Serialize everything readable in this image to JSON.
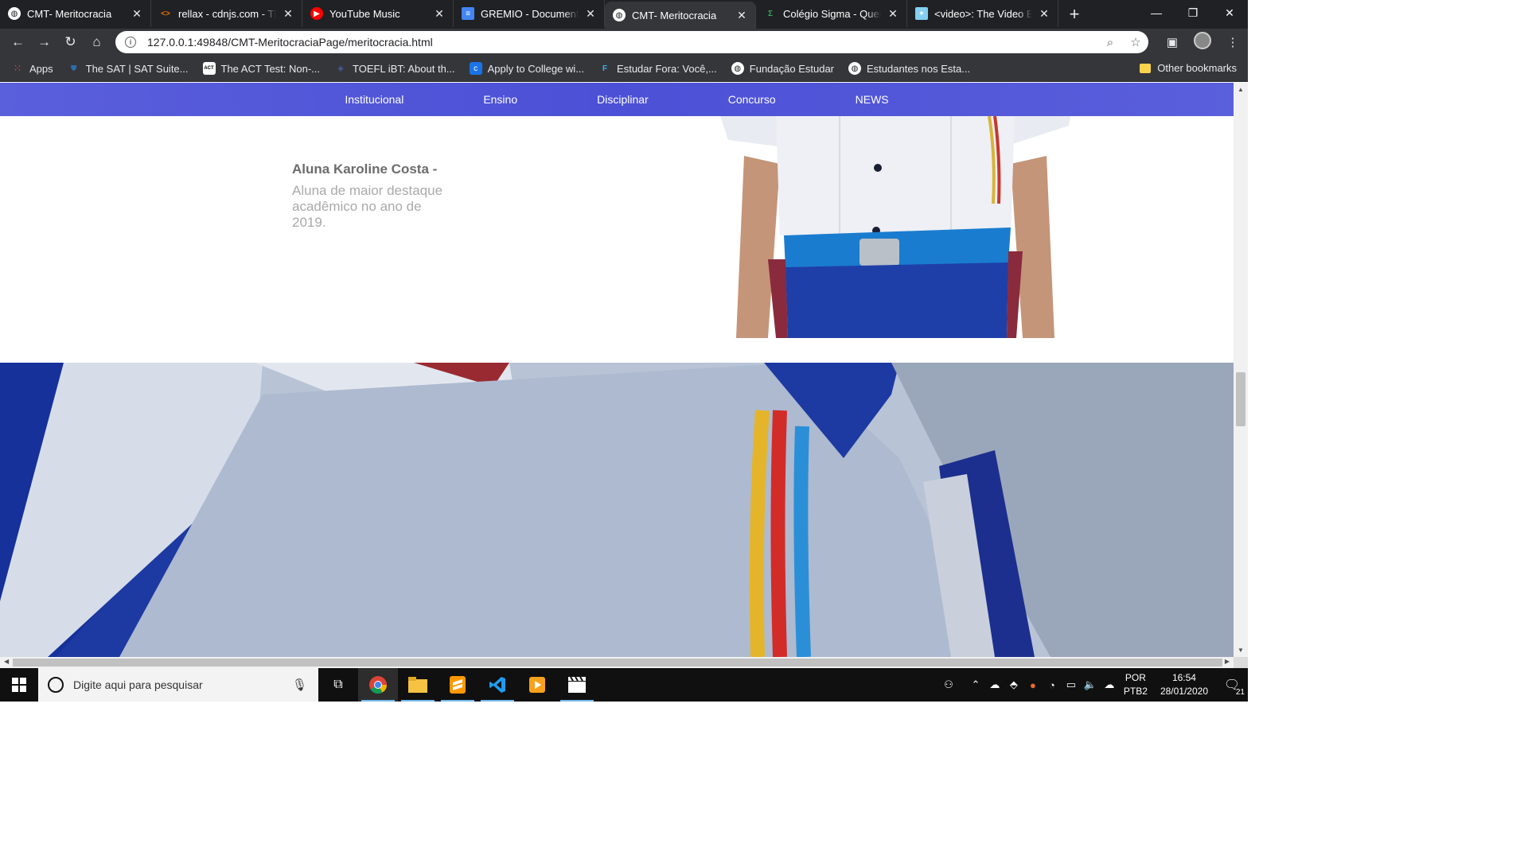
{
  "tabs": [
    {
      "title": "CMT- Meritocracia",
      "icon": "globe-icon",
      "active": false
    },
    {
      "title": "rellax - cdnjs.com - The",
      "icon": "code-icon",
      "active": false
    },
    {
      "title": "YouTube Music",
      "icon": "youtube-music-icon",
      "active": false
    },
    {
      "title": "GREMIO - Documento",
      "icon": "docs-icon",
      "active": false
    },
    {
      "title": "CMT- Meritocracia",
      "icon": "globe-icon",
      "active": true
    },
    {
      "title": "Colégio Sigma - Quem",
      "icon": "sigma-icon",
      "active": false
    },
    {
      "title": "<video>: The Video Em",
      "icon": "mdn-icon",
      "active": false
    }
  ],
  "address_bar": {
    "url": "127.0.0.1:49848/CMT-MeritocraciaPage/meritocracia.html"
  },
  "bookmarks": [
    {
      "label": "Apps",
      "icon": "apps-grid-icon"
    },
    {
      "label": "The SAT | SAT Suite...",
      "icon": "shield-icon"
    },
    {
      "label": "The ACT Test: Non-...",
      "icon": "act-icon"
    },
    {
      "label": "TOEFL iBT: About th...",
      "icon": "ets-icon"
    },
    {
      "label": "Apply to College wi...",
      "icon": "commonapp-icon"
    },
    {
      "label": "Estudar Fora: Você,...",
      "icon": "ef-icon"
    },
    {
      "label": "Fundação Estudar",
      "icon": "globe-icon"
    },
    {
      "label": "Estudantes nos Esta...",
      "icon": "globe-icon"
    }
  ],
  "other_bookmarks": "Other bookmarks",
  "site_nav": [
    "Institucional",
    "Ensino",
    "Disciplinar",
    "Concurso",
    "NEWS"
  ],
  "student": {
    "name": "Aluna Karoline Costa -",
    "description": "Aluna de maior destaque acadêmico no ano de 2019."
  },
  "taskbar": {
    "search_placeholder": "Digite aqui para pesquisar",
    "language": "POR",
    "layout": "PTB2",
    "time": "16:54",
    "date": "28/01/2020",
    "notifications": "21"
  },
  "colors": {
    "nav_background": "#5054d8",
    "tab_strip": "#202124",
    "toolbar": "#35363a"
  }
}
